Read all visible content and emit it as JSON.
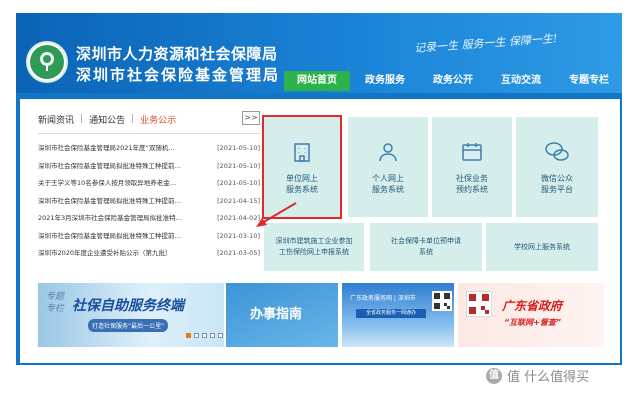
{
  "header": {
    "title_line1": "深圳市人力资源和社会保障局",
    "title_line2": "深圳市社会保险基金管理局",
    "slogan": "记录一生  服务一生  保障一生!"
  },
  "nav": {
    "items": [
      {
        "label": "网站首页",
        "active": true
      },
      {
        "label": "政务服务",
        "active": false
      },
      {
        "label": "政务公开",
        "active": false
      },
      {
        "label": "互动交流",
        "active": false
      },
      {
        "label": "专题专栏",
        "active": false
      }
    ]
  },
  "news": {
    "tabs": [
      "新闻资讯",
      "通知公告",
      "业务公示"
    ],
    "separator": "|",
    "active_tab": "业务公示",
    "more_label": ">>",
    "items": [
      {
        "text": "深圳市社会保险基金管理局2021年度“双随机…",
        "date": "[2021-05-10]"
      },
      {
        "text": "深圳市社会保险基金管理局拟批准特殊工种提前…",
        "date": "[2021-05-10]"
      },
      {
        "text": "关于王学义等10名参保人按月领取异地养老金…",
        "date": "[2021-05-10]"
      },
      {
        "text": "深圳市社会保险基金管理局拟批准特殊工种提前…",
        "date": "[2021-04-15]"
      },
      {
        "text": "2021年3月深圳市社会保险基金管理局拟批准特…",
        "date": "[2021-04-02]"
      },
      {
        "text": "深圳市社会保险基金管理局拟批准特殊工种提前…",
        "date": "[2021-03-10]"
      },
      {
        "text": "深圳市2020年度企业遭受补贴公示（第九批）",
        "date": "[2021-03-05]"
      }
    ]
  },
  "tiles": {
    "unit": [
      "单位网上",
      "服务系统"
    ],
    "personal": [
      "个人网上",
      "服务系统"
    ],
    "booking": [
      "社保业务",
      "预约系统"
    ],
    "wechat": [
      "微信公众",
      "服务平台"
    ],
    "construction": [
      "深圳市建筑施工企业参加",
      "工伤保险网上申报系统"
    ],
    "card": [
      "社会保障卡单位预申请",
      "系统"
    ],
    "school": [
      "学校网上服务系统"
    ]
  },
  "banners": {
    "terminal": {
      "side": "专题专栏",
      "main": "社保自助服务终端",
      "sub": "打造社保服务“最后一公里”"
    },
    "guide": {
      "label": "办事指南"
    },
    "gov": {
      "title": "广东政务服务网 | 深圳市",
      "bar": "全省政务服务一网通办"
    },
    "gd": {
      "line1": "广东省政府",
      "line2": "“互联网+督查”"
    }
  },
  "watermark": {
    "text": "值 什么值得买",
    "icon": "值"
  },
  "colors": {
    "header_blue": "#1276c8",
    "nav_active": "#2cb24a",
    "tile_bg": "#d6eeeb",
    "highlight_red": "#e02a2a",
    "tab_active": "#e0452b"
  }
}
